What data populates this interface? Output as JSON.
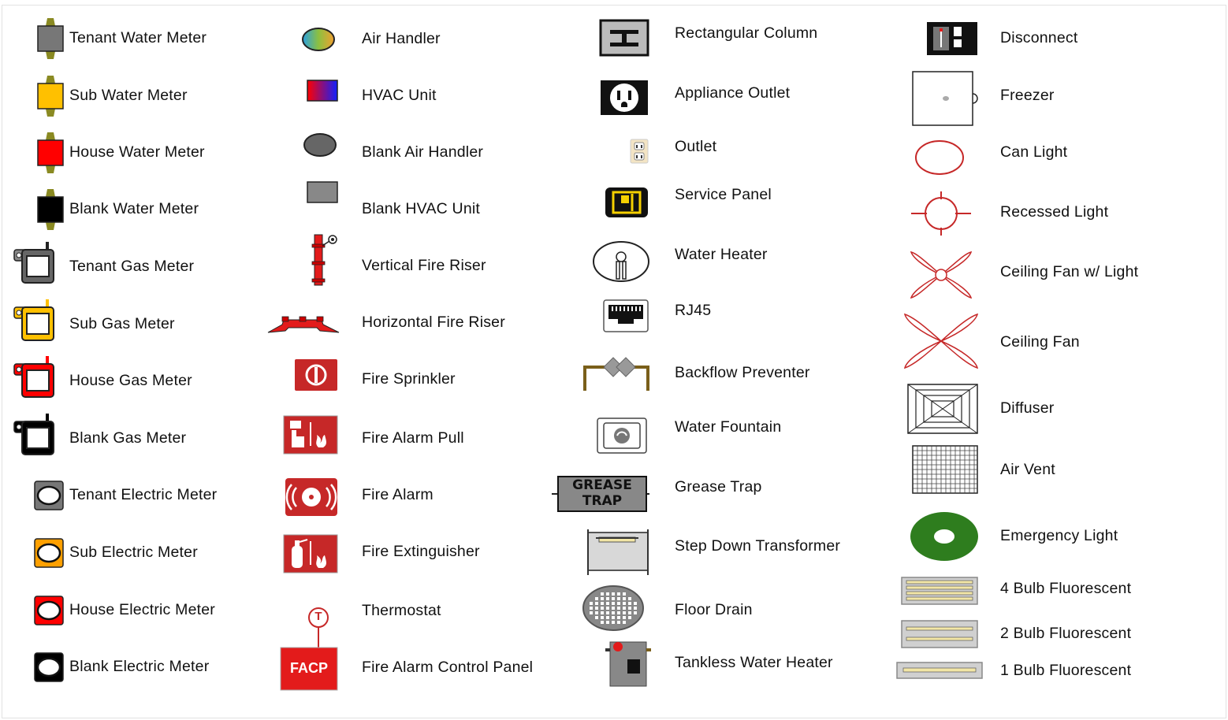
{
  "legend": {
    "columns": [
      {
        "name": "meters",
        "items": [
          {
            "label": "Tenant Water Meter",
            "icon": "tenant-water-meter-icon",
            "color": "#777777"
          },
          {
            "label": "Sub Water Meter",
            "icon": "sub-water-meter-icon",
            "color": "#FFC000"
          },
          {
            "label": "House Water Meter",
            "icon": "house-water-meter-icon",
            "color": "#FF0000"
          },
          {
            "label": "Blank Water Meter",
            "icon": "blank-water-meter-icon",
            "color": "#000000"
          },
          {
            "label": "Tenant Gas Meter",
            "icon": "tenant-gas-meter-icon",
            "color": "#777777"
          },
          {
            "label": "Sub Gas Meter",
            "icon": "sub-gas-meter-icon",
            "color": "#FFC000"
          },
          {
            "label": "House Gas Meter",
            "icon": "house-gas-meter-icon",
            "color": "#FF0000"
          },
          {
            "label": "Blank Gas Meter",
            "icon": "blank-gas-meter-icon",
            "color": "#000000"
          },
          {
            "label": "Tenant Electric Meter",
            "icon": "tenant-electric-meter-icon",
            "color": "#777777"
          },
          {
            "label": "Sub Electric Meter",
            "icon": "sub-electric-meter-icon",
            "color": "#FFA000"
          },
          {
            "label": "House Electric Meter",
            "icon": "house-electric-meter-icon",
            "color": "#FF0000"
          },
          {
            "label": "Blank Electric Meter",
            "icon": "blank-electric-meter-icon",
            "color": "#000000"
          }
        ]
      },
      {
        "name": "hvac-fire",
        "items": [
          {
            "label": "Air Handler",
            "icon": "air-handler-icon"
          },
          {
            "label": "HVAC Unit",
            "icon": "hvac-unit-icon"
          },
          {
            "label": "Blank Air Handler",
            "icon": "blank-air-handler-icon"
          },
          {
            "label": "Blank HVAC Unit",
            "icon": "blank-hvac-unit-icon"
          },
          {
            "label": "Vertical Fire Riser",
            "icon": "vertical-fire-riser-icon"
          },
          {
            "label": "Horizontal Fire Riser",
            "icon": "horizontal-fire-riser-icon"
          },
          {
            "label": "Fire Sprinkler",
            "icon": "fire-sprinkler-icon"
          },
          {
            "label": "Fire Alarm Pull",
            "icon": "fire-alarm-pull-icon"
          },
          {
            "label": "Fire Alarm",
            "icon": "fire-alarm-icon"
          },
          {
            "label": "Fire Extinguisher",
            "icon": "fire-extinguisher-icon"
          },
          {
            "label": "Thermostat",
            "icon": "thermostat-icon",
            "glyph": "T"
          },
          {
            "label": "Fire Alarm Control Panel",
            "icon": "facp-icon",
            "glyph": "FACP"
          }
        ]
      },
      {
        "name": "structure-plumbing",
        "items": [
          {
            "label": "Rectangular Column",
            "icon": "rectangular-column-icon"
          },
          {
            "label": "Appliance Outlet",
            "icon": "appliance-outlet-icon"
          },
          {
            "label": "Outlet",
            "icon": "outlet-icon"
          },
          {
            "label": "Service Panel",
            "icon": "service-panel-icon"
          },
          {
            "label": "Water Heater",
            "icon": "water-heater-icon"
          },
          {
            "label": "RJ45",
            "icon": "rj45-icon"
          },
          {
            "label": "Backflow Preventer",
            "icon": "backflow-preventer-icon"
          },
          {
            "label": "Water Fountain",
            "icon": "water-fountain-icon"
          },
          {
            "label": "Grease Trap",
            "icon": "grease-trap-icon",
            "glyph_lines": [
              "GREASE",
              "TRAP"
            ]
          },
          {
            "label": "Step Down Transformer",
            "icon": "step-down-transformer-icon"
          },
          {
            "label": "Floor Drain",
            "icon": "floor-drain-icon"
          },
          {
            "label": "Tankless Water Heater",
            "icon": "tankless-water-heater-icon"
          }
        ]
      },
      {
        "name": "lighting-misc",
        "items": [
          {
            "label": "Disconnect",
            "icon": "disconnect-icon"
          },
          {
            "label": "Freezer",
            "icon": "freezer-icon"
          },
          {
            "label": "Can Light",
            "icon": "can-light-icon"
          },
          {
            "label": "Recessed Light",
            "icon": "recessed-light-icon"
          },
          {
            "label": "Ceiling Fan w/ Light",
            "icon": "ceiling-fan-light-icon"
          },
          {
            "label": "Ceiling Fan",
            "icon": "ceiling-fan-icon"
          },
          {
            "label": "Diffuser",
            "icon": "diffuser-icon"
          },
          {
            "label": "Air Vent",
            "icon": "air-vent-icon"
          },
          {
            "label": "Emergency Light",
            "icon": "emergency-light-icon"
          },
          {
            "label": "4 Bulb Fluorescent",
            "icon": "four-bulb-fluorescent-icon"
          },
          {
            "label": "2 Bulb Fluorescent",
            "icon": "two-bulb-fluorescent-icon"
          },
          {
            "label": "1 Bulb Fluorescent",
            "icon": "one-bulb-fluorescent-icon"
          }
        ]
      }
    ]
  }
}
